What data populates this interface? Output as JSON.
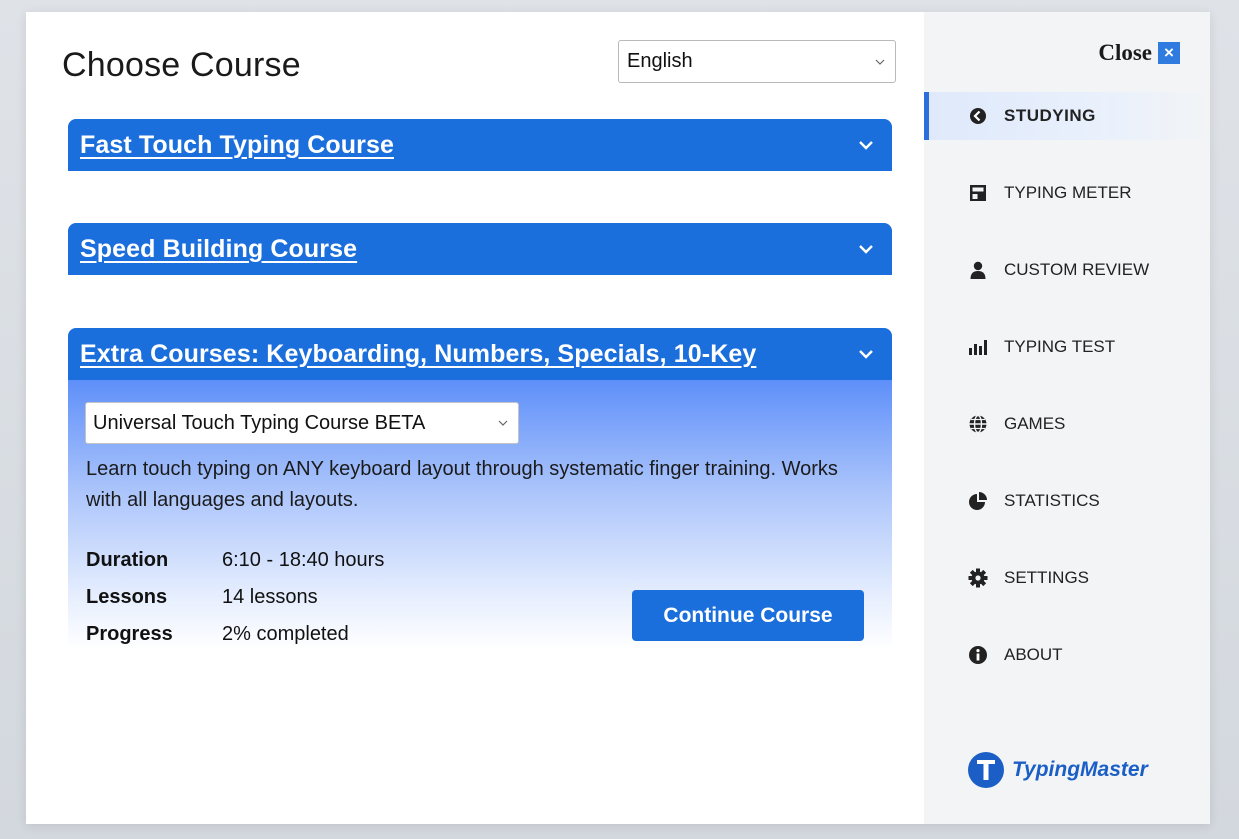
{
  "page": {
    "title": "Choose Course"
  },
  "language": {
    "selected": "English"
  },
  "courses": [
    {
      "title": "Fast Touch Typing Course",
      "expanded": false
    },
    {
      "title": "Speed Building Course",
      "expanded": false
    },
    {
      "title": "Extra Courses: Keyboarding, Numbers, Specials, 10-Key",
      "expanded": true,
      "selected_course": "Universal Touch Typing Course BETA",
      "description": "Learn touch typing on ANY keyboard layout through systematic finger training. Works with all languages and layouts.",
      "details": [
        {
          "label": "Duration",
          "value": "6:10 - 18:40 hours"
        },
        {
          "label": "Lessons",
          "value": "14 lessons"
        },
        {
          "label": "Progress",
          "value": "2% completed"
        }
      ],
      "action_label": "Continue Course"
    }
  ],
  "sidebar": {
    "close_label": "Close",
    "close_icon": "×",
    "items": [
      {
        "label": "STUDYING",
        "icon": "arrow-left-circle-icon",
        "active": true
      },
      {
        "label": "TYPING METER",
        "icon": "typing-meter-icon",
        "active": false
      },
      {
        "label": "CUSTOM REVIEW",
        "icon": "user-icon",
        "active": false
      },
      {
        "label": "TYPING TEST",
        "icon": "bar-chart-icon",
        "active": false
      },
      {
        "label": "GAMES",
        "icon": "globe-icon",
        "active": false
      },
      {
        "label": "STATISTICS",
        "icon": "pie-chart-icon",
        "active": false
      },
      {
        "label": "SETTINGS",
        "icon": "gear-icon",
        "active": false
      },
      {
        "label": "ABOUT",
        "icon": "info-icon",
        "active": false
      }
    ],
    "brand": "TypingMaster"
  },
  "colors": {
    "accent": "#1b6fdc",
    "sidebar_bg": "#f2f4f6"
  }
}
